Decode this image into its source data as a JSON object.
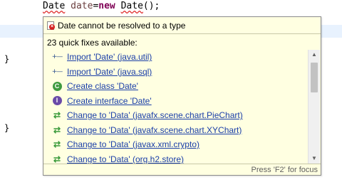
{
  "editor": {
    "code": {
      "type": "Date",
      "var": "date",
      "assign": "=",
      "kw_new": "new",
      "ctor": "Date",
      "tail": "();"
    },
    "braces": [
      "}",
      "}"
    ]
  },
  "quickfix": {
    "title": "Date cannot be resolved to a type",
    "count_label": "23 quick fixes available:",
    "items": [
      {
        "icon": "import-icon",
        "label": "Import 'Date' (java.util)"
      },
      {
        "icon": "import-icon",
        "label": "Import 'Date' (java.sql)"
      },
      {
        "icon": "new-class-icon",
        "label": "Create class 'Date'"
      },
      {
        "icon": "new-interface-icon",
        "label": "Create interface 'Date'"
      },
      {
        "icon": "change-icon",
        "label": "Change to 'Data' (javafx.scene.chart.PieChart)"
      },
      {
        "icon": "change-icon",
        "label": "Change to 'Data' (javafx.scene.chart.XYChart)"
      },
      {
        "icon": "change-icon",
        "label": "Change to 'Data' (javax.xml.crypto)"
      },
      {
        "icon": "change-icon",
        "label": "Change to 'Data' (org.h2.store)"
      }
    ],
    "footer": "Press 'F2' for focus"
  }
}
